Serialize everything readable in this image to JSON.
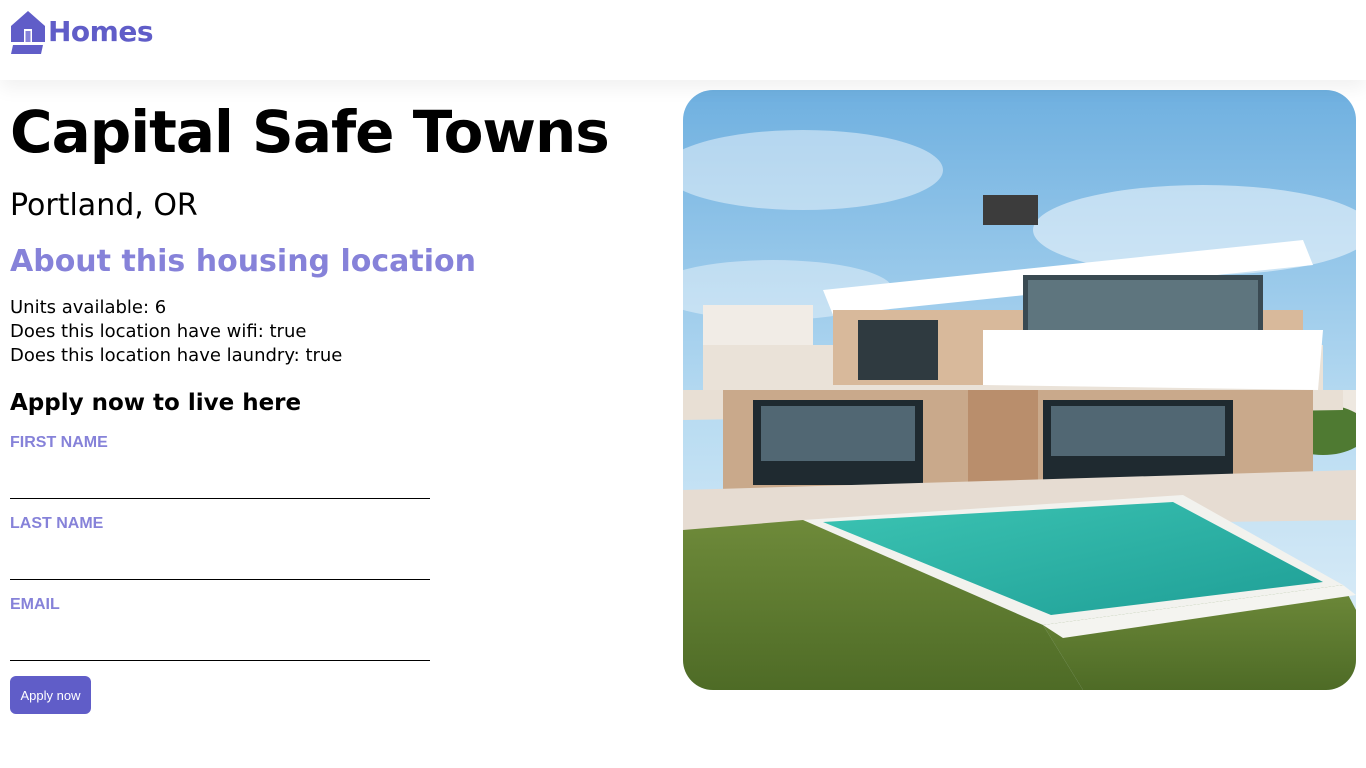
{
  "header": {
    "brand_name": "Homes",
    "logo_icon": "house-icon",
    "brand_color": "#605DC8"
  },
  "listing": {
    "name": "Capital Safe Towns",
    "location": "Portland, OR",
    "photo_icon": "house-photo"
  },
  "about": {
    "heading": "About this housing location",
    "heading_color": "#8682D9",
    "features": [
      "Units available: 6",
      "Does this location have wifi: true",
      "Does this location have laundry: true"
    ]
  },
  "apply_form": {
    "heading": "Apply now to live here",
    "first_name_label": "First Name",
    "first_name_value": "",
    "last_name_label": "Last Name",
    "last_name_value": "",
    "email_label": "Email",
    "email_value": "",
    "submit_label": "Apply now"
  }
}
